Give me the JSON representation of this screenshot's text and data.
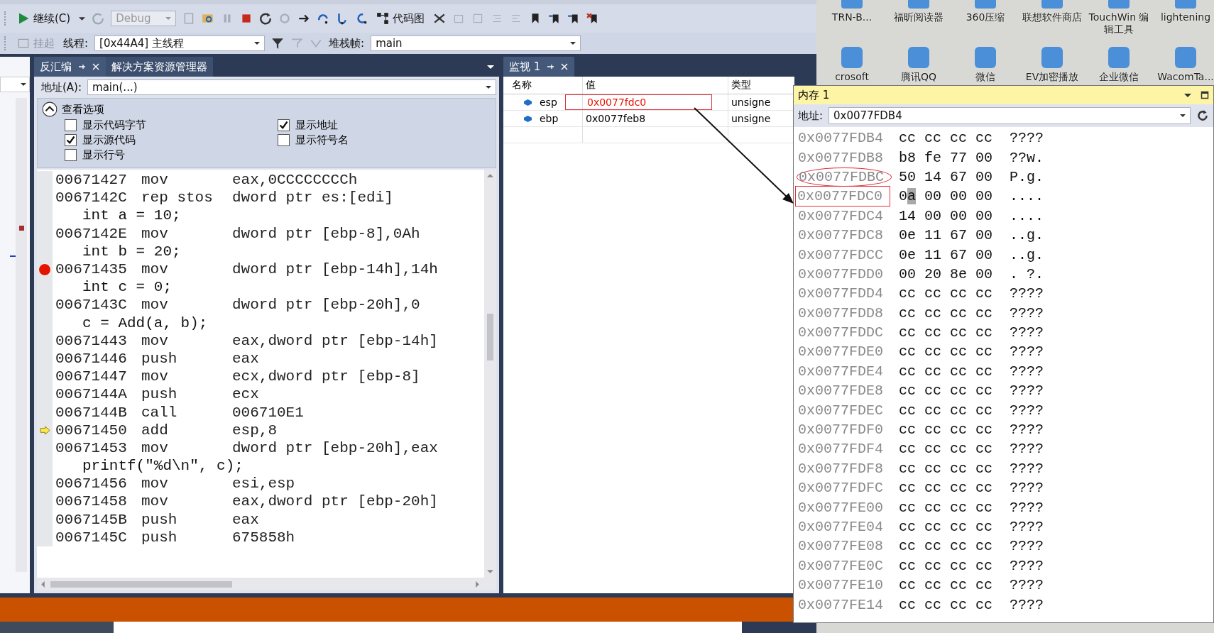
{
  "toolbar": {
    "continue": "继续(C)",
    "config": "Debug",
    "code_map": "代码图",
    "suspend": "挂起",
    "thread_label": "线程:",
    "thread": "[0x44A4] 主线程",
    "frame_label": "堆栈帧:",
    "frame": "main"
  },
  "desktop": {
    "icons": [
      {
        "label": "TRN-B..."
      },
      {
        "label": "福昕阅读器"
      },
      {
        "label": "360压缩"
      },
      {
        "label": "联想软件商店"
      },
      {
        "label": "TouchWin 编辑工具"
      },
      {
        "label": "lightening"
      },
      {
        "label": "crosoft"
      },
      {
        "label": "腾讯QQ"
      },
      {
        "label": "微信"
      },
      {
        "label": "EV加密播放"
      },
      {
        "label": "企业微信"
      },
      {
        "label": "WacomTa..."
      }
    ]
  },
  "disasm": {
    "tabs": [
      {
        "label": "反汇编",
        "selected": true
      },
      {
        "label": "解决方案资源管理器",
        "selected": false
      }
    ],
    "address_label": "地址(A):",
    "address": "main(...)",
    "options_title": "查看选项",
    "options_expanded": true,
    "options": [
      {
        "label": "显示代码字节",
        "checked": false
      },
      {
        "label": "显示地址",
        "checked": true
      },
      {
        "label": "显示源代码",
        "checked": true
      },
      {
        "label": "显示符号名",
        "checked": false
      },
      {
        "label": "显示行号",
        "checked": false
      }
    ],
    "lines": [
      {
        "kind": "asm",
        "addr": "00671427",
        "op": "mov",
        "args": "eax,0CCCCCCCCh",
        "breakpoint": false,
        "current": false
      },
      {
        "kind": "asm",
        "addr": "0067142C",
        "op": "rep stos",
        "args": "dword ptr es:[edi]",
        "breakpoint": false,
        "current": false
      },
      {
        "kind": "src",
        "text": "int a = 10;",
        "breakpoint": false,
        "current": false
      },
      {
        "kind": "asm",
        "addr": "0067142E",
        "op": "mov",
        "args": "dword ptr [ebp-8],0Ah",
        "breakpoint": false,
        "current": false
      },
      {
        "kind": "src",
        "text": "int b = 20;",
        "breakpoint": false,
        "current": false
      },
      {
        "kind": "asm",
        "addr": "00671435",
        "op": "mov",
        "args": "dword ptr [ebp-14h],14h",
        "breakpoint": true,
        "current": false
      },
      {
        "kind": "src",
        "text": "int c = 0;",
        "breakpoint": false,
        "current": false
      },
      {
        "kind": "asm",
        "addr": "0067143C",
        "op": "mov",
        "args": "dword ptr [ebp-20h],0",
        "breakpoint": false,
        "current": false
      },
      {
        "kind": "src",
        "text": "c = Add(a, b);",
        "breakpoint": false,
        "current": false
      },
      {
        "kind": "asm",
        "addr": "00671443",
        "op": "mov",
        "args": "eax,dword ptr [ebp-14h]",
        "breakpoint": false,
        "current": false
      },
      {
        "kind": "asm",
        "addr": "00671446",
        "op": "push",
        "args": "eax",
        "breakpoint": false,
        "current": false
      },
      {
        "kind": "asm",
        "addr": "00671447",
        "op": "mov",
        "args": "ecx,dword ptr [ebp-8]",
        "breakpoint": false,
        "current": false
      },
      {
        "kind": "asm",
        "addr": "0067144A",
        "op": "push",
        "args": "ecx",
        "breakpoint": false,
        "current": false
      },
      {
        "kind": "asm",
        "addr": "0067144B",
        "op": "call",
        "args": "006710E1",
        "breakpoint": false,
        "current": false
      },
      {
        "kind": "asm",
        "addr": "00671450",
        "op": "add",
        "args": "esp,8",
        "breakpoint": false,
        "current": true
      },
      {
        "kind": "asm",
        "addr": "00671453",
        "op": "mov",
        "args": "dword ptr [ebp-20h],eax",
        "breakpoint": false,
        "current": false
      },
      {
        "kind": "src",
        "text": "printf(\"%d\\n\", c);",
        "breakpoint": false,
        "current": false
      },
      {
        "kind": "asm",
        "addr": "00671456",
        "op": "mov",
        "args": "esi,esp",
        "breakpoint": false,
        "current": false
      },
      {
        "kind": "asm",
        "addr": "00671458",
        "op": "mov",
        "args": "eax,dword ptr [ebp-20h]",
        "breakpoint": false,
        "current": false
      },
      {
        "kind": "asm",
        "addr": "0067145B",
        "op": "push",
        "args": "eax",
        "breakpoint": false,
        "current": false
      },
      {
        "kind": "asm",
        "addr": "0067145C",
        "op": "push",
        "args": "675858h",
        "breakpoint": false,
        "current": false
      }
    ]
  },
  "watch": {
    "tab": {
      "label": "监视 1",
      "selected": true
    },
    "columns": [
      "名称",
      "值",
      "类型"
    ],
    "rows": [
      {
        "name": "esp",
        "value": "0x0077fdc0",
        "type": "unsigne",
        "changed": true,
        "boxed": true
      },
      {
        "name": "ebp",
        "value": "0x0077feb8",
        "type": "unsigne",
        "changed": false,
        "boxed": false
      }
    ]
  },
  "memory": {
    "title": "内存 1",
    "address_label": "地址:",
    "address": "0x0077FDB4",
    "rows": [
      {
        "addr": "0x0077FDB4",
        "bytes": [
          "cc",
          "cc",
          "cc",
          "cc"
        ],
        "ascii": "????",
        "circled": false,
        "boxed": false,
        "cursor": false
      },
      {
        "addr": "0x0077FDB8",
        "bytes": [
          "b8",
          "fe",
          "77",
          "00"
        ],
        "ascii": "??w.",
        "circled": false,
        "boxed": false,
        "cursor": false
      },
      {
        "addr": "0x0077FDBC",
        "bytes": [
          "50",
          "14",
          "67",
          "00"
        ],
        "ascii": "P.g.",
        "circled": true,
        "boxed": false,
        "cursor": false
      },
      {
        "addr": "0x0077FDC0",
        "bytes": [
          "0a",
          "00",
          "00",
          "00"
        ],
        "ascii": "....",
        "circled": false,
        "boxed": true,
        "cursor": true
      },
      {
        "addr": "0x0077FDC4",
        "bytes": [
          "14",
          "00",
          "00",
          "00"
        ],
        "ascii": "....",
        "circled": false,
        "boxed": false,
        "cursor": false
      },
      {
        "addr": "0x0077FDC8",
        "bytes": [
          "0e",
          "11",
          "67",
          "00"
        ],
        "ascii": "..g.",
        "circled": false,
        "boxed": false,
        "cursor": false
      },
      {
        "addr": "0x0077FDCC",
        "bytes": [
          "0e",
          "11",
          "67",
          "00"
        ],
        "ascii": "..g.",
        "circled": false,
        "boxed": false,
        "cursor": false
      },
      {
        "addr": "0x0077FDD0",
        "bytes": [
          "00",
          "20",
          "8e",
          "00"
        ],
        "ascii": ". ?.",
        "circled": false,
        "boxed": false,
        "cursor": false
      },
      {
        "addr": "0x0077FDD4",
        "bytes": [
          "cc",
          "cc",
          "cc",
          "cc"
        ],
        "ascii": "????",
        "circled": false,
        "boxed": false,
        "cursor": false
      },
      {
        "addr": "0x0077FDD8",
        "bytes": [
          "cc",
          "cc",
          "cc",
          "cc"
        ],
        "ascii": "????",
        "circled": false,
        "boxed": false,
        "cursor": false
      },
      {
        "addr": "0x0077FDDC",
        "bytes": [
          "cc",
          "cc",
          "cc",
          "cc"
        ],
        "ascii": "????",
        "circled": false,
        "boxed": false,
        "cursor": false
      },
      {
        "addr": "0x0077FDE0",
        "bytes": [
          "cc",
          "cc",
          "cc",
          "cc"
        ],
        "ascii": "????",
        "circled": false,
        "boxed": false,
        "cursor": false
      },
      {
        "addr": "0x0077FDE4",
        "bytes": [
          "cc",
          "cc",
          "cc",
          "cc"
        ],
        "ascii": "????",
        "circled": false,
        "boxed": false,
        "cursor": false
      },
      {
        "addr": "0x0077FDE8",
        "bytes": [
          "cc",
          "cc",
          "cc",
          "cc"
        ],
        "ascii": "????",
        "circled": false,
        "boxed": false,
        "cursor": false
      },
      {
        "addr": "0x0077FDEC",
        "bytes": [
          "cc",
          "cc",
          "cc",
          "cc"
        ],
        "ascii": "????",
        "circled": false,
        "boxed": false,
        "cursor": false
      },
      {
        "addr": "0x0077FDF0",
        "bytes": [
          "cc",
          "cc",
          "cc",
          "cc"
        ],
        "ascii": "????",
        "circled": false,
        "boxed": false,
        "cursor": false
      },
      {
        "addr": "0x0077FDF4",
        "bytes": [
          "cc",
          "cc",
          "cc",
          "cc"
        ],
        "ascii": "????",
        "circled": false,
        "boxed": false,
        "cursor": false
      },
      {
        "addr": "0x0077FDF8",
        "bytes": [
          "cc",
          "cc",
          "cc",
          "cc"
        ],
        "ascii": "????",
        "circled": false,
        "boxed": false,
        "cursor": false
      },
      {
        "addr": "0x0077FDFC",
        "bytes": [
          "cc",
          "cc",
          "cc",
          "cc"
        ],
        "ascii": "????",
        "circled": false,
        "boxed": false,
        "cursor": false
      },
      {
        "addr": "0x0077FE00",
        "bytes": [
          "cc",
          "cc",
          "cc",
          "cc"
        ],
        "ascii": "????",
        "circled": false,
        "boxed": false,
        "cursor": false
      },
      {
        "addr": "0x0077FE04",
        "bytes": [
          "cc",
          "cc",
          "cc",
          "cc"
        ],
        "ascii": "????",
        "circled": false,
        "boxed": false,
        "cursor": false
      },
      {
        "addr": "0x0077FE08",
        "bytes": [
          "cc",
          "cc",
          "cc",
          "cc"
        ],
        "ascii": "????",
        "circled": false,
        "boxed": false,
        "cursor": false
      },
      {
        "addr": "0x0077FE0C",
        "bytes": [
          "cc",
          "cc",
          "cc",
          "cc"
        ],
        "ascii": "????",
        "circled": false,
        "boxed": false,
        "cursor": false
      },
      {
        "addr": "0x0077FE10",
        "bytes": [
          "cc",
          "cc",
          "cc",
          "cc"
        ],
        "ascii": "????",
        "circled": false,
        "boxed": false,
        "cursor": false
      },
      {
        "addr": "0x0077FE14",
        "bytes": [
          "cc",
          "cc",
          "cc",
          "cc"
        ],
        "ascii": "????",
        "circled": false,
        "boxed": false,
        "cursor": false
      }
    ]
  }
}
